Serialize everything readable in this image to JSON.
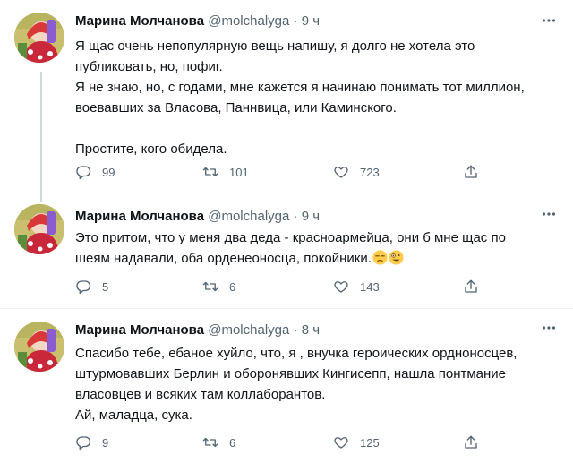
{
  "tweets": [
    {
      "name": "Марина Молчанова",
      "handle": "@molchalyga",
      "dot": "·",
      "time": "9 ч",
      "lines": [
        "Я щас очень непопулярную вещь напишу, я долго не хотела это",
        "публиковать, но, пофиг.",
        "Я не знаю, но, с годами, мне кажется я начинаю понимать тот миллион,",
        "воевавших за Власова, Паннвица, или Каминского.",
        "",
        "Простите, кого обидела."
      ],
      "replies": "99",
      "retweets": "101",
      "likes": "723"
    },
    {
      "name": "Марина Молчанова",
      "handle": "@molchalyga",
      "dot": "·",
      "time": "9 ч",
      "lines": [
        "Это притом, что у меня два деда - красноармейца, они б мне щас по",
        "шеям надавали, оба орденеоносца, покойники."
      ],
      "emojis": [
        "unamused-face-emoji",
        "zany-face-emoji"
      ],
      "replies": "5",
      "retweets": "6",
      "likes": "143"
    },
    {
      "name": "Марина Молчанова",
      "handle": "@molchalyga",
      "dot": "·",
      "time": "8 ч",
      "lines": [
        "Спасибо тебе, ебаное хуйло, что, я , внучка героических ордноносцев,",
        "штурмовавших Берлин и оборонявших Кингисепп, нашла понтмание",
        "власовцев и всяких там коллаборантов.",
        "Ай, маладца, сука."
      ],
      "replies": "9",
      "retweets": "6",
      "likes": "125"
    }
  ],
  "icons": {
    "more": "more-icon",
    "reply": "reply-icon",
    "retweet": "retweet-icon",
    "like": "heart-icon",
    "share": "share-icon"
  },
  "colors": {
    "text": "#0f1419",
    "secondary": "#536471",
    "thread_line": "#cfd9de",
    "divider": "#eff3f4"
  }
}
